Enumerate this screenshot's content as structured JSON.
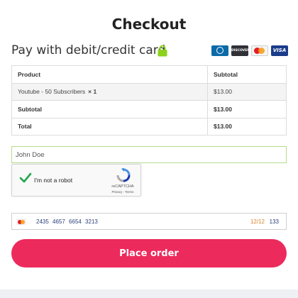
{
  "page": {
    "title": "Checkout"
  },
  "payment": {
    "heading": "Pay with debit/credit card",
    "lock_icon": "lock-icon",
    "lock_color": "#8bd21a",
    "card_logos": [
      {
        "name": "diners-club-icon",
        "label": ""
      },
      {
        "name": "discover-icon",
        "label": "DISCOVER"
      },
      {
        "name": "mastercard-icon",
        "label": ""
      },
      {
        "name": "visa-icon",
        "label": "VISA"
      }
    ]
  },
  "order_table": {
    "headers": {
      "product": "Product",
      "subtotal": "Subtotal"
    },
    "item": {
      "name": "Youtube - 50 Subscribers",
      "qty": "× 1",
      "price": "$13.00"
    },
    "subtotal": {
      "label": "Subtotal",
      "value": "$13.00"
    },
    "total": {
      "label": "Total",
      "value": "$13.00"
    }
  },
  "form": {
    "name_value": "John Doe",
    "captcha": {
      "label": "I'm not a robot",
      "brand": "reCAPTCHA",
      "links": "Privacy - Terms",
      "checked": true
    },
    "card": {
      "brand_icon": "mastercard-icon",
      "number": "2435 4657 6654 3213",
      "expiry": "12/12",
      "cvc": "133"
    }
  },
  "actions": {
    "place_order": "Place order",
    "accent": "#ec2a5c"
  }
}
